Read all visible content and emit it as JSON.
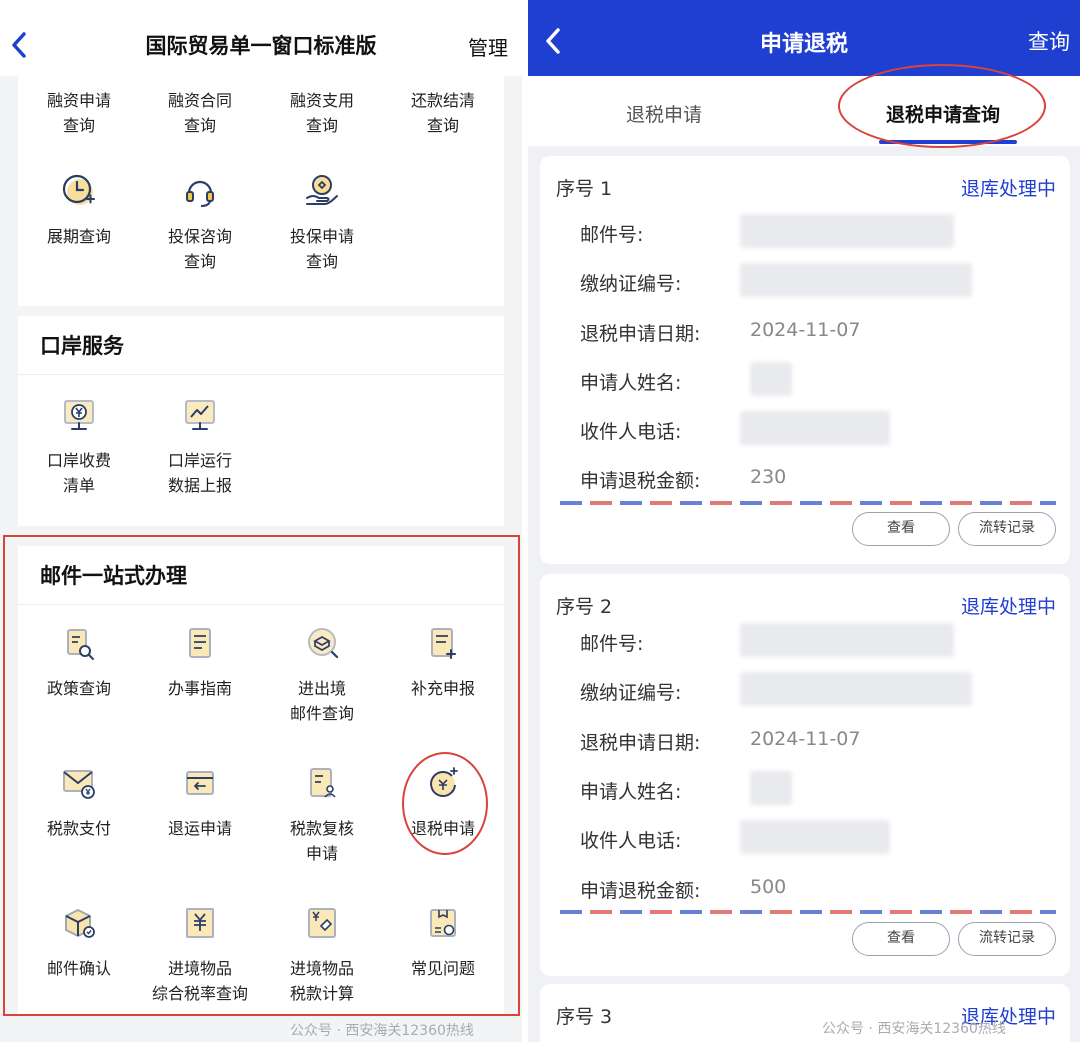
{
  "left": {
    "header": {
      "title": "国际贸易单一窗口标准版",
      "manage": "管理"
    },
    "finance_items": [
      {
        "label1": "融资申请",
        "label2": "查询"
      },
      {
        "label1": "融资合同",
        "label2": "查询"
      },
      {
        "label1": "融资支用",
        "label2": "查询"
      },
      {
        "label1": "还款结清",
        "label2": "查询"
      },
      {
        "label1": "展期查询",
        "label2": ""
      },
      {
        "label1": "投保咨询",
        "label2": "查询"
      },
      {
        "label1": "投保申请",
        "label2": "查询"
      }
    ],
    "port": {
      "title": "口岸服务",
      "items": [
        {
          "label1": "口岸收费",
          "label2": "清单"
        },
        {
          "label1": "口岸运行",
          "label2": "数据上报"
        }
      ]
    },
    "mail": {
      "title": "邮件一站式办理",
      "items": [
        {
          "label1": "政策查询",
          "label2": ""
        },
        {
          "label1": "办事指南",
          "label2": ""
        },
        {
          "label1": "进出境",
          "label2": "邮件查询"
        },
        {
          "label1": "补充申报",
          "label2": ""
        },
        {
          "label1": "税款支付",
          "label2": ""
        },
        {
          "label1": "退运申请",
          "label2": ""
        },
        {
          "label1": "税款复核",
          "label2": "申请"
        },
        {
          "label1": "退税申请",
          "label2": ""
        },
        {
          "label1": "邮件确认",
          "label2": ""
        },
        {
          "label1": "进境物品",
          "label2": "综合税率查询"
        },
        {
          "label1": "进境物品",
          "label2": "税款计算"
        },
        {
          "label1": "常见问题",
          "label2": ""
        }
      ]
    },
    "watermark": "公众号 · 西安海关12360热线"
  },
  "right": {
    "header": {
      "title": "申请退税",
      "query": "查询"
    },
    "tabs": {
      "tab1": "退税申请",
      "tab2": "退税申请查询"
    },
    "labels": {
      "mail_no": "邮件号:",
      "cert_no": "缴纳证编号:",
      "date": "退税申请日期:",
      "applicant": "申请人姓名:",
      "phone": "收件人电话:",
      "amount": "申请退税金额:"
    },
    "buttons": {
      "view": "查看",
      "flow": "流转记录"
    },
    "records": [
      {
        "seq": "序号 1",
        "status": "退库处理中",
        "date": "2024-11-07",
        "amount": "230"
      },
      {
        "seq": "序号 2",
        "status": "退库处理中",
        "date": "2024-11-07",
        "amount": "500"
      },
      {
        "seq": "序号 3",
        "status": "退库处理中"
      }
    ],
    "watermark": "公众号 · 西安海关12360热线"
  },
  "colors": {
    "brand_blue": "#1f3fd1",
    "annotation_red": "#d9433b",
    "icon_yellow": "#f3c64a"
  }
}
